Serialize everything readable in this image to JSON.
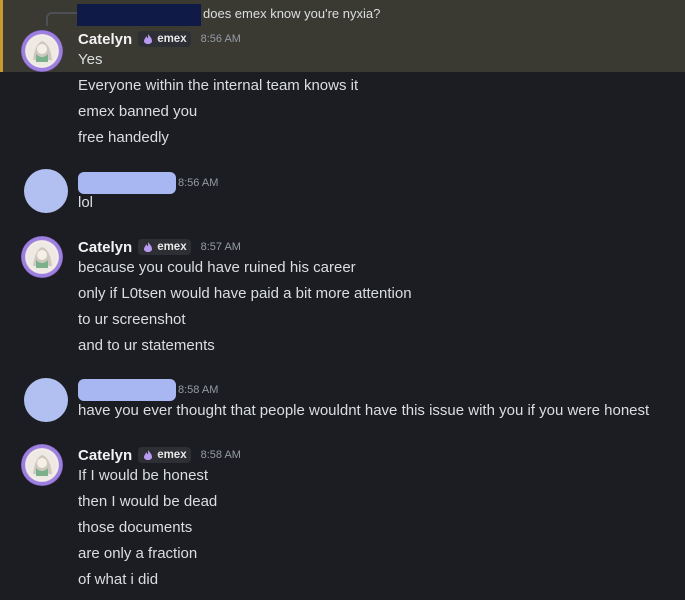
{
  "reply": {
    "text": "does emex know you're nyxia?"
  },
  "messages": [
    {
      "author": "Catelyn",
      "tag": "emex",
      "time": "8:56 AM",
      "lines": [
        "Yes",
        "Everyone within the internal team knows it",
        "emex banned you",
        "free handedly"
      ]
    },
    {
      "author": "",
      "time": "8:56 AM",
      "lines": [
        "lol"
      ]
    },
    {
      "author": "Catelyn",
      "tag": "emex",
      "time": "8:57 AM",
      "lines": [
        "because you could have ruined his career",
        "only if L0tsen would have paid a bit more attention",
        "to ur screenshot",
        "and to ur statements"
      ]
    },
    {
      "author": "",
      "time": "8:58 AM",
      "lines": [
        "have you ever thought that people wouldnt have this issue with you if you were honest"
      ]
    },
    {
      "author": "Catelyn",
      "tag": "emex",
      "time": "8:58 AM",
      "lines": [
        "If I would be honest",
        "then I would be dead",
        "those documents",
        "are only a fraction",
        "of what i did"
      ]
    }
  ],
  "colors": {
    "background": "#1c1d22",
    "highlight": "#3b3a32",
    "highlight_bar": "#c99a2e",
    "redaction_dark": "#0f1a47",
    "redaction_light": "#a8b6f2"
  }
}
